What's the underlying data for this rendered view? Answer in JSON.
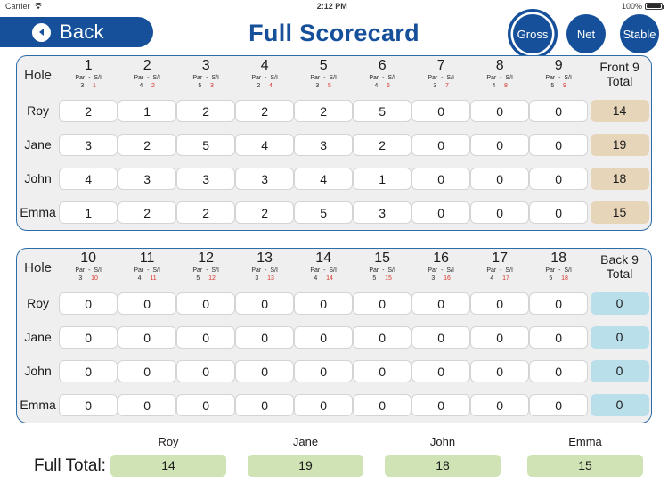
{
  "status_bar": {
    "carrier": "Carrier",
    "wifi_icon": "wifi-icon",
    "time": "2:12 PM",
    "battery_percent": "100%",
    "battery_icon": "battery-icon"
  },
  "navbar": {
    "back_label": "Back",
    "back_icon": "chevron-left-icon",
    "title": "Full Scorecard",
    "modes": [
      {
        "label": "Gross",
        "selected": true
      },
      {
        "label": "Net",
        "selected": false
      },
      {
        "label": "Stable",
        "selected": false
      }
    ]
  },
  "theme": {
    "brand_blue": "#16509B",
    "panel_border": "#2D6CA8",
    "panel_bg": "#EFEFEF",
    "si_red": "#D8342B",
    "front_total_bg": "#E6D5B8",
    "back_total_bg": "#B9DFEB",
    "full_total_bg": "#CFE3B4"
  },
  "front_nine": {
    "hole_label": "Hole",
    "par_si_label": "Par  -  S/I",
    "total_label_line1": "Front 9",
    "total_label_line2": "Total",
    "holes": [
      {
        "number": "1",
        "par": "3",
        "si": "1"
      },
      {
        "number": "2",
        "par": "4",
        "si": "2"
      },
      {
        "number": "3",
        "par": "5",
        "si": "3"
      },
      {
        "number": "4",
        "par": "2",
        "si": "4"
      },
      {
        "number": "5",
        "par": "3",
        "si": "5"
      },
      {
        "number": "6",
        "par": "4",
        "si": "6"
      },
      {
        "number": "7",
        "par": "3",
        "si": "7"
      },
      {
        "number": "8",
        "par": "4",
        "si": "8"
      },
      {
        "number": "9",
        "par": "5",
        "si": "9"
      }
    ],
    "players": [
      {
        "name": "Roy",
        "scores": [
          "2",
          "1",
          "2",
          "2",
          "2",
          "5",
          "0",
          "0",
          "0"
        ],
        "total": "14"
      },
      {
        "name": "Jane",
        "scores": [
          "3",
          "2",
          "5",
          "4",
          "3",
          "2",
          "0",
          "0",
          "0"
        ],
        "total": "19"
      },
      {
        "name": "John",
        "scores": [
          "4",
          "3",
          "3",
          "3",
          "4",
          "1",
          "0",
          "0",
          "0"
        ],
        "total": "18"
      },
      {
        "name": "Emma",
        "scores": [
          "1",
          "2",
          "2",
          "2",
          "5",
          "3",
          "0",
          "0",
          "0"
        ],
        "total": "15"
      }
    ]
  },
  "back_nine": {
    "hole_label": "Hole",
    "par_si_label": "Par  -  S/I",
    "total_label_line1": "Back 9",
    "total_label_line2": "Total",
    "holes": [
      {
        "number": "10",
        "par": "3",
        "si": "10"
      },
      {
        "number": "11",
        "par": "4",
        "si": "11"
      },
      {
        "number": "12",
        "par": "5",
        "si": "12"
      },
      {
        "number": "13",
        "par": "3",
        "si": "13"
      },
      {
        "number": "14",
        "par": "4",
        "si": "14"
      },
      {
        "number": "15",
        "par": "5",
        "si": "15"
      },
      {
        "number": "16",
        "par": "3",
        "si": "16"
      },
      {
        "number": "17",
        "par": "4",
        "si": "17"
      },
      {
        "number": "18",
        "par": "5",
        "si": "18"
      }
    ],
    "players": [
      {
        "name": "Roy",
        "scores": [
          "0",
          "0",
          "0",
          "0",
          "0",
          "0",
          "0",
          "0",
          "0"
        ],
        "total": "0"
      },
      {
        "name": "Jane",
        "scores": [
          "0",
          "0",
          "0",
          "0",
          "0",
          "0",
          "0",
          "0",
          "0"
        ],
        "total": "0"
      },
      {
        "name": "John",
        "scores": [
          "0",
          "0",
          "0",
          "0",
          "0",
          "0",
          "0",
          "0",
          "0"
        ],
        "total": "0"
      },
      {
        "name": "Emma",
        "scores": [
          "0",
          "0",
          "0",
          "0",
          "0",
          "0",
          "0",
          "0",
          "0"
        ],
        "total": "0"
      }
    ]
  },
  "footer": {
    "label": "Full Total:",
    "entries": [
      {
        "name": "Roy",
        "total": "14"
      },
      {
        "name": "Jane",
        "total": "19"
      },
      {
        "name": "John",
        "total": "18"
      },
      {
        "name": "Emma",
        "total": "15"
      }
    ]
  }
}
